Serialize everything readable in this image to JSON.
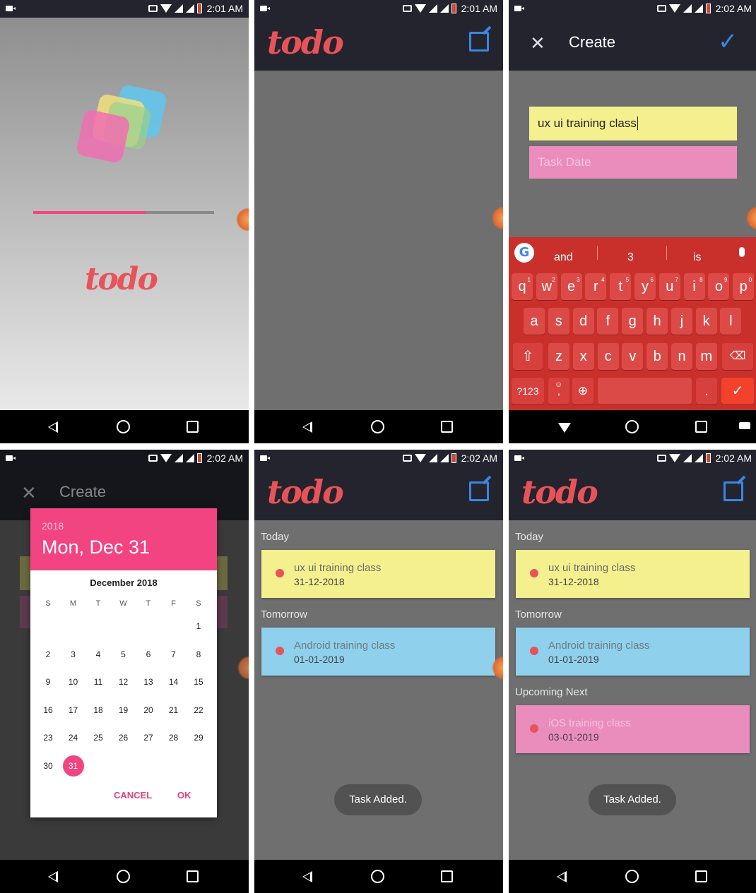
{
  "status_times": [
    "2:01 AM",
    "2:01 AM",
    "2:02 AM",
    "2:02 AM",
    "2:02 AM",
    "2:02 AM"
  ],
  "splash": {
    "logo": "todo",
    "progress": 0.62
  },
  "home": {
    "logo": "todo"
  },
  "create": {
    "title": "Create",
    "task_input_value": "ux ui training class",
    "task_date_placeholder": "Task Date"
  },
  "keyboard": {
    "suggestions": [
      "and",
      "3",
      "is"
    ],
    "row1": [
      {
        "k": "q",
        "s": "1"
      },
      {
        "k": "w",
        "s": "2"
      },
      {
        "k": "e",
        "s": "3"
      },
      {
        "k": "r",
        "s": "4"
      },
      {
        "k": "t",
        "s": "5"
      },
      {
        "k": "y",
        "s": "6"
      },
      {
        "k": "u",
        "s": "7"
      },
      {
        "k": "i",
        "s": "8"
      },
      {
        "k": "o",
        "s": "9"
      },
      {
        "k": "p",
        "s": "0"
      }
    ],
    "row2": [
      "a",
      "s",
      "d",
      "f",
      "g",
      "h",
      "j",
      "k",
      "l"
    ],
    "row3": [
      "z",
      "x",
      "c",
      "v",
      "b",
      "n",
      "m"
    ],
    "symbols_key": "?123",
    "comma_key": ",",
    "period_key": "."
  },
  "datepicker": {
    "background_title": "Create",
    "year": "2018",
    "selected_date": "Mon, Dec 31",
    "month_label": "December 2018",
    "weekdays": [
      "S",
      "M",
      "T",
      "W",
      "T",
      "F",
      "S"
    ],
    "weeks": [
      [
        "",
        "",
        "",
        "",
        "",
        "",
        "1"
      ],
      [
        "2",
        "3",
        "4",
        "5",
        "6",
        "7",
        "8"
      ],
      [
        "9",
        "10",
        "11",
        "12",
        "13",
        "14",
        "15"
      ],
      [
        "16",
        "17",
        "18",
        "19",
        "20",
        "21",
        "22"
      ],
      [
        "23",
        "24",
        "25",
        "26",
        "27",
        "28",
        "29"
      ],
      [
        "30",
        "31",
        "",
        "",
        "",
        "",
        ""
      ]
    ],
    "selected_day": "31",
    "cancel": "CANCEL",
    "ok": "OK"
  },
  "list1": {
    "sections": [
      {
        "label": "Today",
        "task": "ux ui training class",
        "date": "31-12-2018",
        "color": "#f5f08e"
      },
      {
        "label": "Tomorrow",
        "task": "Android training class",
        "date": "01-01-2019",
        "color": "#8fd0ec"
      }
    ],
    "toast": "Task Added."
  },
  "list2": {
    "sections": [
      {
        "label": "Today",
        "task": "ux ui training class",
        "date": "31-12-2018",
        "color": "#f5f08e"
      },
      {
        "label": "Tomorrow",
        "task": "Android training class",
        "date": "01-01-2019",
        "color": "#8fd0ec"
      },
      {
        "label": "Upcoming Next",
        "task": "iOS training class",
        "date": "03-01-2019",
        "color": "#ea8dbd"
      }
    ],
    "toast": "Task Added."
  },
  "colors": {
    "accent": "#f24481",
    "appbar": "#23242e",
    "logo": "#e8535a",
    "keyboard": "#c9302c",
    "compose": "#3a86e0"
  }
}
